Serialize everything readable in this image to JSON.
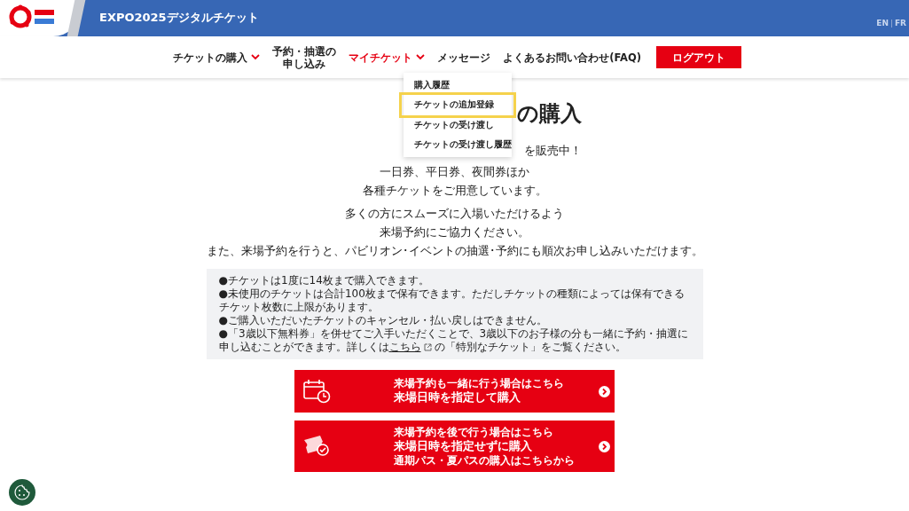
{
  "header": {
    "title": "EXPO2025デジタルチケット",
    "languages": [
      {
        "label": "EN"
      },
      {
        "label": "FR"
      }
    ]
  },
  "nav": {
    "items": [
      {
        "label": "チケットの購入",
        "has_caret": true,
        "selected": false
      },
      {
        "label": "予約・抽選の申し込み",
        "has_caret": false,
        "selected": false
      },
      {
        "label": "マイチケット",
        "has_caret": true,
        "selected": true
      },
      {
        "label": "メッセージ",
        "has_caret": false,
        "selected": false
      },
      {
        "label": "よくあるお問い合わせ(FAQ)",
        "has_caret": false,
        "selected": false
      }
    ],
    "logout": "ログアウト"
  },
  "dropdown": {
    "items": [
      {
        "label": "購入履歴",
        "focused": false
      },
      {
        "label": "チケットの追加登録",
        "focused": true
      },
      {
        "label": "チケットの受け渡し",
        "focused": false
      },
      {
        "label": "チケットの受け渡し履歴",
        "focused": false
      }
    ]
  },
  "main": {
    "title_visible": "の購入",
    "lead_visible": "を販売中！",
    "lines": [
      "一日券、平日券、夜間券ほか",
      "各種チケットをご用意しています。"
    ],
    "lines2": [
      "多くの方にスムーズに入場いただけるよう",
      "来場予約にご協力ください。",
      "また、来場予約を行うと、パビリオン･イベントの抽選･予約にも順次お申し込みいただけます。"
    ],
    "notes": [
      "●チケットは1度に14枚まで購入できます。",
      "●未使用のチケットは合計100枚まで保有できます。ただしチケットの種類によっては保有できるチケット枚数に上限があります。",
      "●ご購入いただいたチケットのキャンセル・払い戻しはできません。"
    ],
    "note_last": {
      "before": "●「3歳以下無料券」を併せてご入手いただくことで、3歳以下のお子様の分も一緒に予約・抽選に申し込むことができます。詳しくは",
      "link": "こちら",
      "after": "の「特別なチケット」をご覧ください。"
    },
    "buttons": [
      {
        "kind": "calendar",
        "sub": "来場予約も一緒に行う場合はこちら",
        "main": "来場日時を指定して購入"
      },
      {
        "kind": "ticket",
        "sub": "来場予約を後で行う場合はこちら",
        "main": "来場日時を指定せずに購入",
        "note": "通期パス・夏パスの購入はこちらから"
      }
    ]
  }
}
